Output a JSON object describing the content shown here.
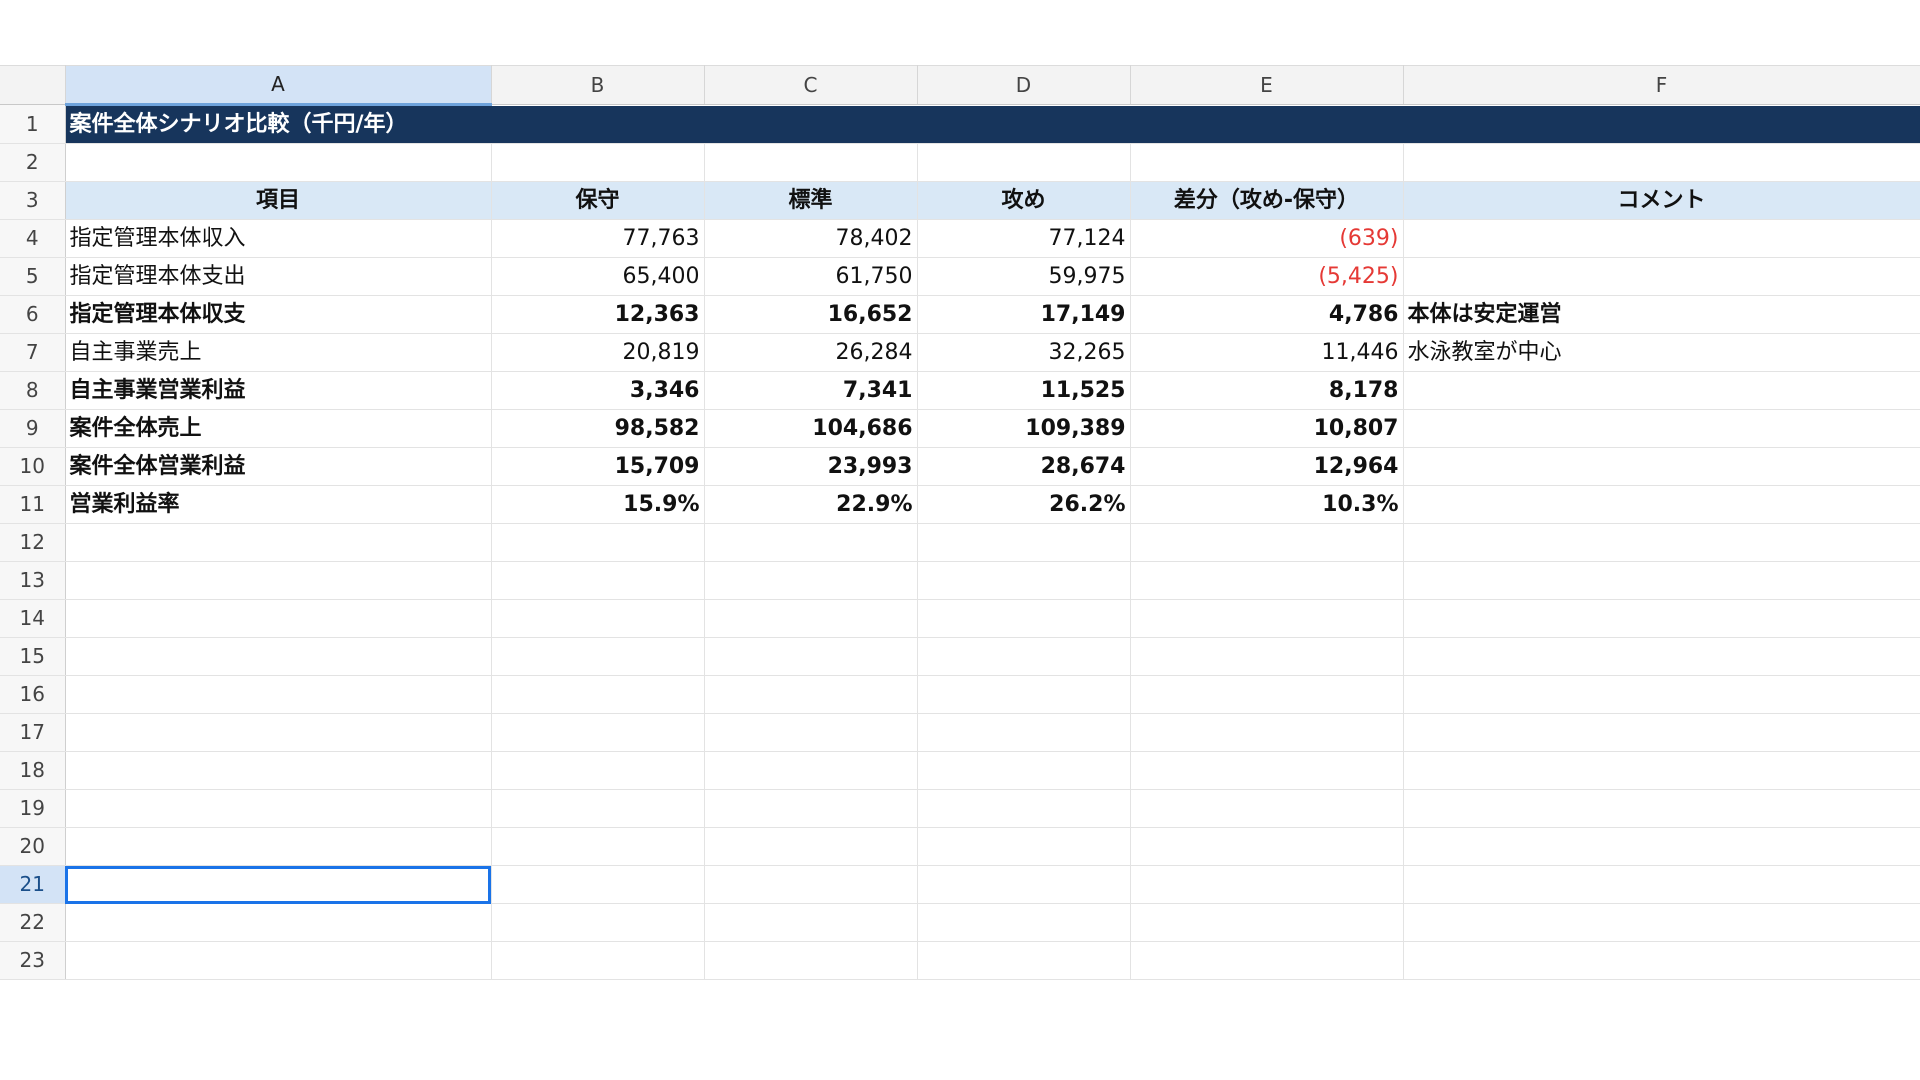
{
  "sheet": {
    "columns": [
      "A",
      "B",
      "C",
      "D",
      "E",
      "F"
    ],
    "selected_column": "A",
    "active_cell": "A21",
    "title": "案件全体シナリオ比較（千円/年）",
    "headers": [
      "項目",
      "保守",
      "標準",
      "攻め",
      "差分（攻め-保守）",
      "コメント"
    ],
    "rows": [
      {
        "item": "指定管理本体収入",
        "b": "77,763",
        "c": "78,402",
        "d": "77,124",
        "e": "(639)",
        "comment": ""
      },
      {
        "item": "指定管理本体支出",
        "b": "65,400",
        "c": "61,750",
        "d": "59,975",
        "e": "(5,425)",
        "comment": ""
      },
      {
        "item": "指定管理本体収支",
        "b": "12,363",
        "c": "16,652",
        "d": "17,149",
        "e": "4,786",
        "comment": "本体は安定運営"
      },
      {
        "item": "自主事業売上",
        "b": "20,819",
        "c": "26,284",
        "d": "32,265",
        "e": "11,446",
        "comment": "水泳教室が中心"
      },
      {
        "item": "自主事業営業利益",
        "b": "3,346",
        "c": "7,341",
        "d": "11,525",
        "e": "8,178",
        "comment": ""
      },
      {
        "item": "案件全体売上",
        "b": "98,582",
        "c": "104,686",
        "d": "109,389",
        "e": "10,807",
        "comment": ""
      },
      {
        "item": "案件全体営業利益",
        "b": "15,709",
        "c": "23,993",
        "d": "28,674",
        "e": "12,964",
        "comment": ""
      },
      {
        "item": "営業利益率",
        "b": "15.9%",
        "c": "22.9%",
        "d": "26.2%",
        "e": "10.3%",
        "comment": ""
      }
    ],
    "row_numbers": [
      "1",
      "2",
      "3",
      "4",
      "5",
      "6",
      "7",
      "8",
      "9",
      "10",
      "11",
      "12",
      "13",
      "14",
      "15",
      "16",
      "17",
      "18",
      "19",
      "20",
      "21",
      "22",
      "23"
    ]
  },
  "colors": {
    "title_bg": "#17355c",
    "header_bg": "#d9e8f6",
    "negative": "#e53935",
    "selection": "#1a73e8"
  }
}
